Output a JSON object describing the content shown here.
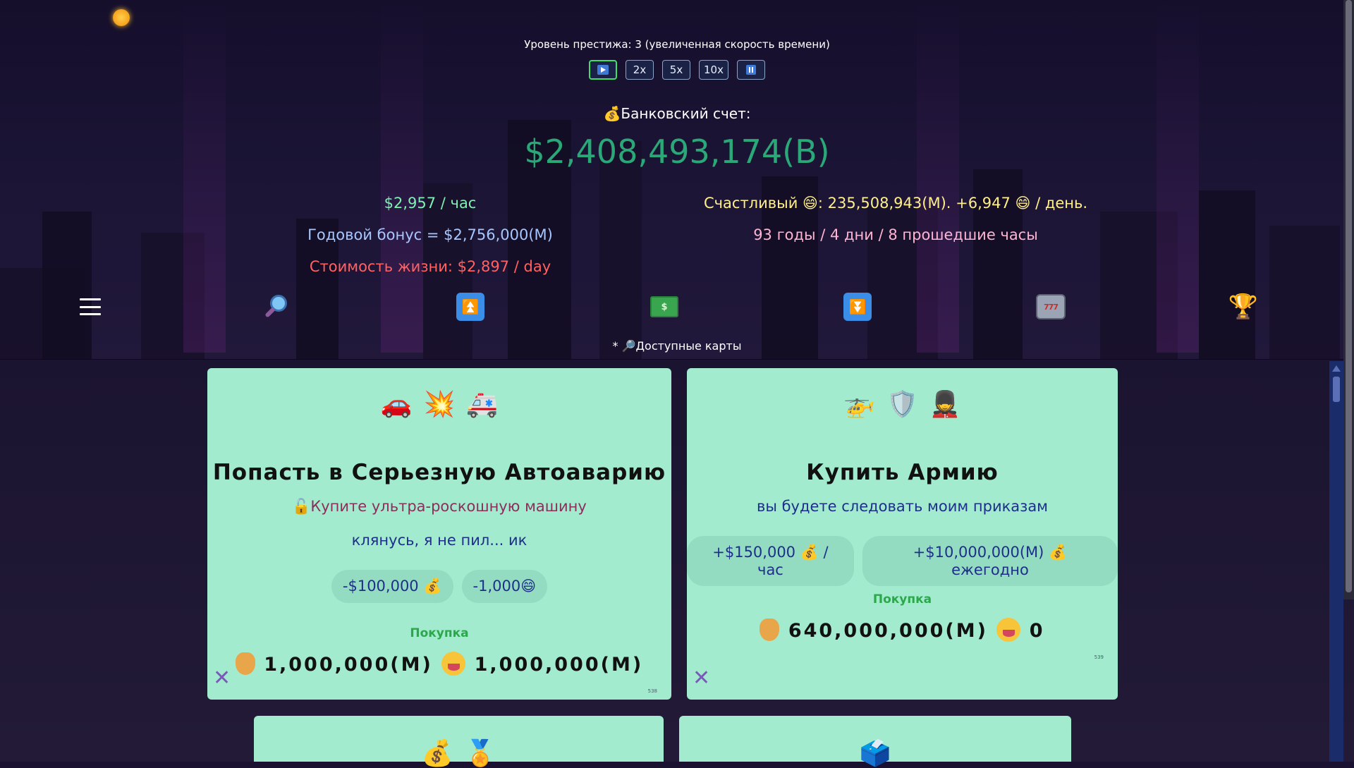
{
  "header": {
    "prestige_text": "Уровень престижа: 3 (увеличенная скорость времени)",
    "speed_buttons": [
      "2x",
      "5x",
      "10x"
    ],
    "bank_label": "💰Банковский счет:",
    "bank_amount": "$2,408,493,174(B)"
  },
  "stats": {
    "hourly": "$2,957 / час",
    "annual_bonus": "Годовой бонус = $2,756,000(M)",
    "cost_of_living": "Стоимость жизни: $2,897 / day",
    "happy": "Счастливый 😄: 235,508,943(M).   +6,947 😄 / день.",
    "elapsed": "93 годы / 4 дни / 8 прошедшие часы"
  },
  "nav": {
    "money_label": "$",
    "slot_label": "777",
    "available_cards": "* 🔎Доступные карты"
  },
  "cards": [
    {
      "emojis": [
        "🚗",
        "💥",
        "🚑"
      ],
      "title": "Попасть в Серьезную Автоаварию",
      "subtitle": "🔓Купите ультра-роскошную машину",
      "subtitle2": "клянусь, я не пил... ик",
      "pills": [
        "-$100,000 💰",
        "-1,000😄"
      ],
      "buy_label": "Покупка",
      "price_money": "1,000,000(M)",
      "price_happy": "1,000,000(M)",
      "id": "538"
    },
    {
      "emojis": [
        "🚁",
        "🛡️",
        "💂"
      ],
      "title": "Купить Армию",
      "subtitle": "вы будете следовать моим приказам",
      "pills": [
        "+$150,000 💰 / час",
        "+$10,000,000(M) 💰 ежегодно"
      ],
      "buy_label": "Покупка",
      "price_money": "640,000,000(M)",
      "price_happy": "0",
      "id": "539"
    }
  ],
  "next_cards": [
    {
      "emojis": [
        "💰",
        "🏅"
      ]
    },
    {
      "emojis": [
        "🗳️"
      ]
    }
  ],
  "colors": {
    "bank_amount": "#2aa878",
    "card_bg": "#a2ebcf",
    "active_speed_border": "#3ee06a",
    "buy_label": "#2aa84a"
  }
}
